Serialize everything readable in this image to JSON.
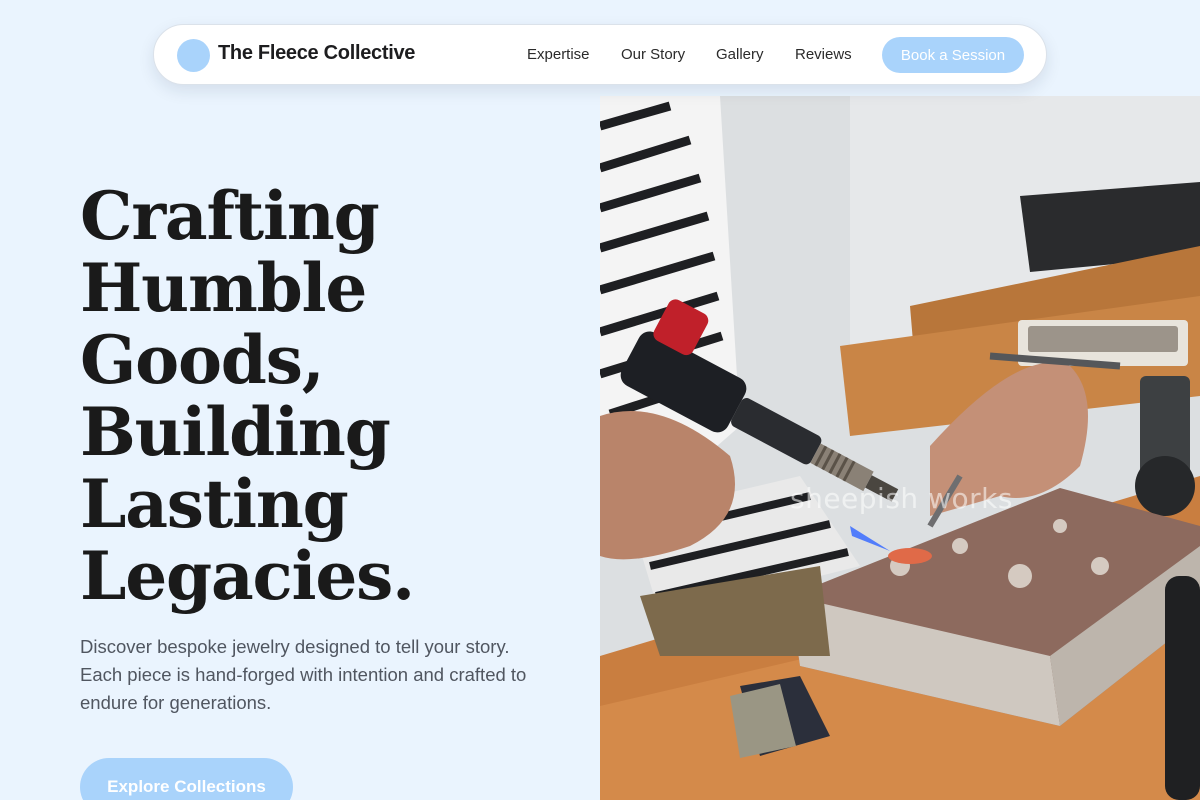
{
  "brand": {
    "name": "The Fleece Collective",
    "logo_color": "#a9d3fb"
  },
  "nav": {
    "links": [
      "Expertise",
      "Our Story",
      "Gallery",
      "Reviews"
    ],
    "cta_label": "Book a Session"
  },
  "hero": {
    "title_lines": [
      "Crafting",
      "Humble",
      "Goods,",
      "Building",
      "Lasting",
      "Legacies."
    ],
    "subtitle": "Discover bespoke jewelry designed to tell your story. Each piece is hand-forged with intention and crafted to endure for generations.",
    "cta_label": "Explore Collections",
    "image": {
      "description_icon": "jeweler-soldering-photo",
      "watermark": "sheepish works"
    }
  },
  "colors": {
    "page_background": "#eaf4fe",
    "accent": "#a9d3fb",
    "heading": "#1a1a1a",
    "body_text": "#505660"
  }
}
